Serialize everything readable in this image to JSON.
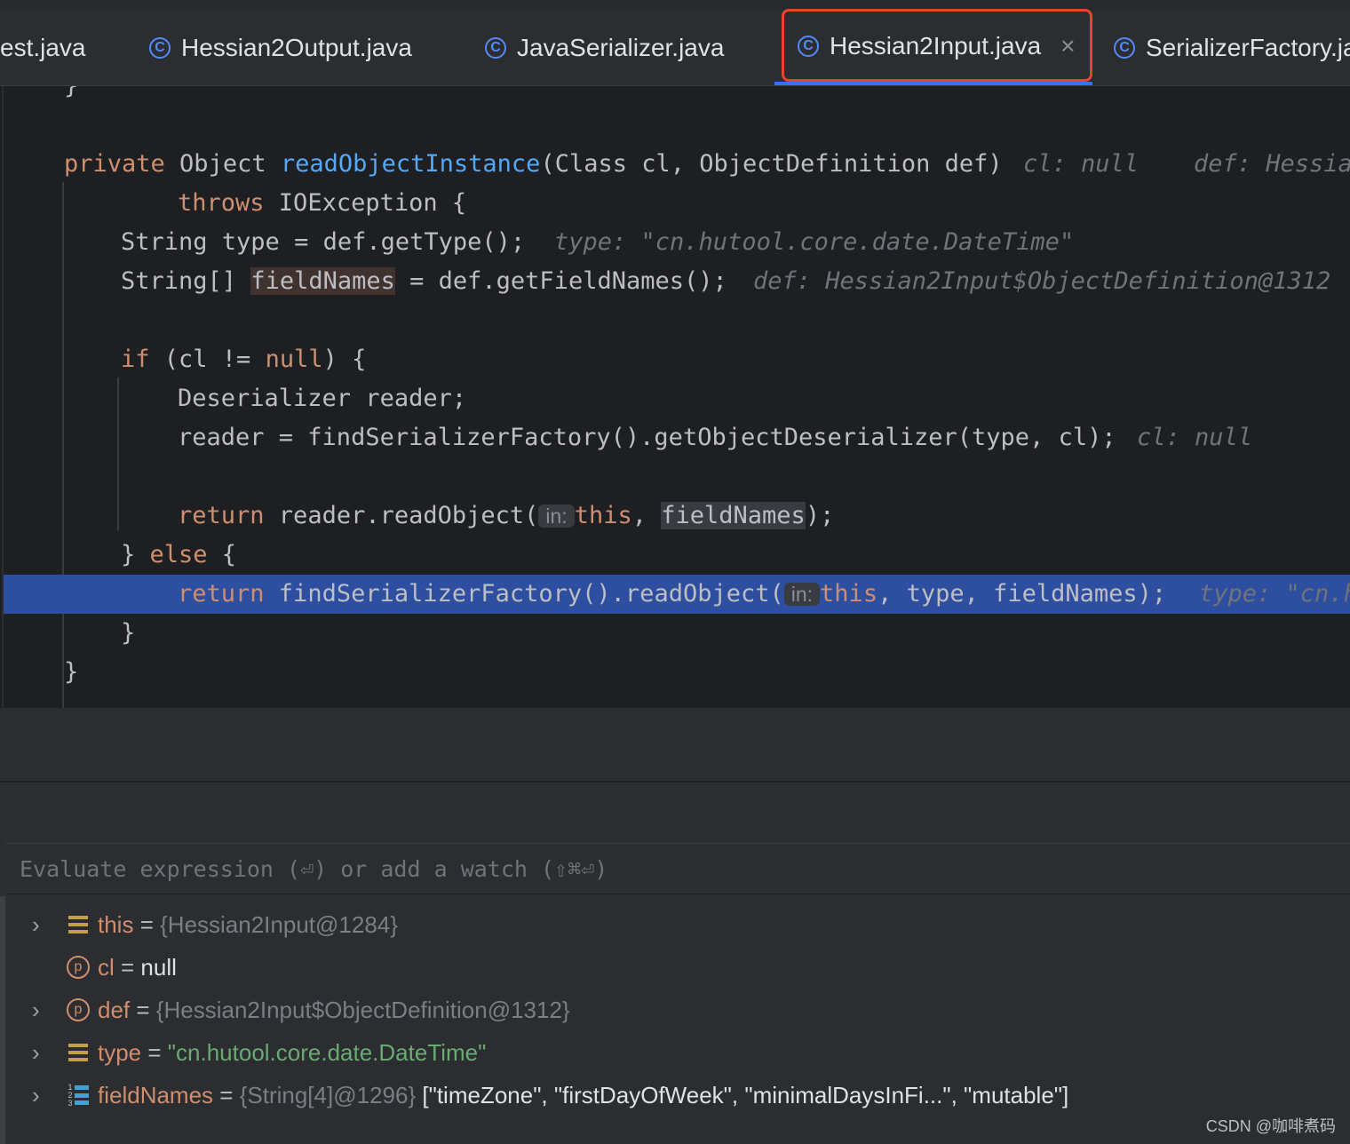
{
  "tabs": [
    {
      "label": "est.java",
      "icon": "class-icon"
    },
    {
      "label": "Hessian2Output.java",
      "icon": "class-icon"
    },
    {
      "label": "JavaSerializer.java",
      "icon": "class-icon"
    },
    {
      "label": "Hessian2Input.java",
      "icon": "class-icon",
      "active": true,
      "close": "×"
    },
    {
      "label": "SerializerFactory.ja",
      "icon": "class-icon"
    }
  ],
  "editor": {
    "lines": {
      "l0": "}",
      "l1_kw": "private",
      "l1_a": " Object ",
      "l1_fn": "readObjectInstance",
      "l1_b": "(Class cl, ObjectDefinition def)",
      "l1_hint1": "cl: null",
      "l1_hint2": "def: Hessia",
      "l2_kw": "throws",
      "l2_a": " IOException {",
      "l3_a": "String type = def.getType();",
      "l3_hint": "type: \"cn.hutool.core.date.DateTime\"",
      "l4_a": "String[] ",
      "l4_b": "fieldNames",
      "l4_c": " = def.getFieldNames();",
      "l4_hint": "def: Hessian2Input$ObjectDefinition@1312",
      "l5_kw": "if",
      "l5_a": " (cl != ",
      "l5_kw2": "null",
      "l5_b": ") {",
      "l6_a": "Deserializer reader;",
      "l7_a": "reader = findSerializerFactory().getObjectDeserializer(type, cl);",
      "l7_hint": "cl: null",
      "l8_kw": "return",
      "l8_a": " reader.readObject(",
      "l8_inlay": "in:",
      "l8_kw2": "this",
      "l8_b": ", ",
      "l8_c": "fieldNames",
      "l8_d": ");",
      "l9_a": "} ",
      "l9_kw": "else",
      "l9_b": " {",
      "l10_kw": "return",
      "l10_a": " findSerializerFactory().readObject(",
      "l10_inlay": "in:",
      "l10_kw2": "this",
      "l10_b": ", type, fieldNames);",
      "l10_hint": "type: \"cn.h",
      "l11": "}",
      "l12": "}"
    }
  },
  "debug": {
    "eval_placeholder": "Evaluate expression (⏎) or add a watch (⇧⌘⏎)",
    "variables": [
      {
        "name": "this",
        "eq": " = ",
        "value": "{Hessian2Input@1284}",
        "icon": "field-icon",
        "expandable": true
      },
      {
        "name": "cl",
        "eq": " = ",
        "value": "null",
        "icon": "parameter-icon",
        "expandable": false
      },
      {
        "name": "def",
        "eq": " = ",
        "value": "{Hessian2Input$ObjectDefinition@1312}",
        "icon": "parameter-icon",
        "expandable": true
      },
      {
        "name": "type",
        "eq": " = ",
        "value": "\"cn.hutool.core.date.DateTime\"",
        "icon": "field-icon",
        "expandable": true
      },
      {
        "name": "fieldNames",
        "eq": " = ",
        "value": "{String[4]@1296}",
        "value2": " [\"timeZone\", \"firstDayOfWeek\", \"minimalDaysInFi...\", \"mutable\"]",
        "icon": "array-icon",
        "expandable": true
      }
    ]
  },
  "icons": {
    "chevron": "›",
    "class_letter": "C",
    "param_letter": "p",
    "array_nums": [
      "1",
      "2",
      "3"
    ]
  },
  "watermark": "CSDN @咖啡煮码",
  "colors": {
    "keyword": "#cf8e6d",
    "function": "#56a8f5",
    "string": "#6aab73",
    "exec_line": "#2e4ea0",
    "highlight_box": "#e8432d",
    "accent": "#548af7"
  }
}
